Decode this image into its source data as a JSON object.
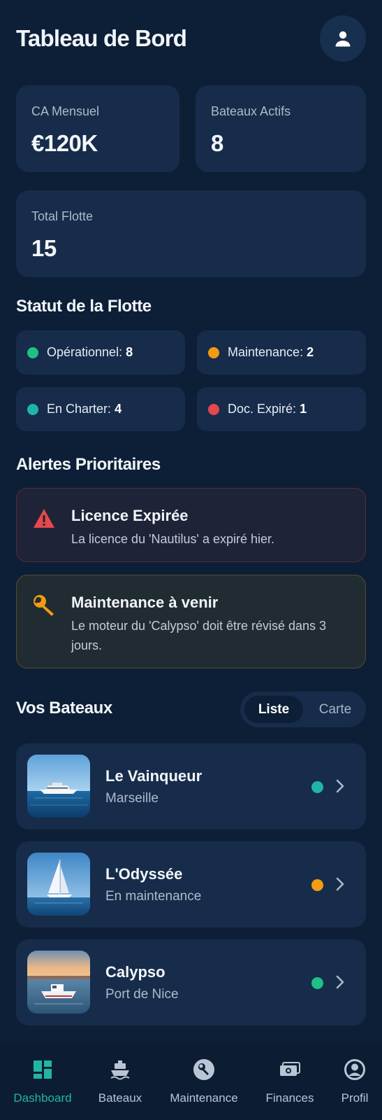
{
  "header": {
    "title": "Tableau de Bord",
    "avatar_icon": "person-icon"
  },
  "stats": [
    {
      "label": "CA Mensuel",
      "value": "€120K"
    },
    {
      "label": "Bateaux Actifs",
      "value": "8"
    },
    {
      "label": "Total Flotte",
      "value": "15"
    }
  ],
  "fleet_status": {
    "title": "Statut de la Flotte",
    "items": [
      {
        "label": "Opérationnel:",
        "count": "8",
        "color": "#1fbf86"
      },
      {
        "label": "Maintenance:",
        "count": "2",
        "color": "#f39c12"
      },
      {
        "label": "En Charter:",
        "count": "4",
        "color": "#1fb5a6"
      },
      {
        "label": "Doc. Expiré:",
        "count": "1",
        "color": "#e5484d"
      }
    ]
  },
  "alerts": {
    "title": "Alertes Prioritaires",
    "items": [
      {
        "icon": "warning-icon",
        "title": "Licence Expirée",
        "message": "La licence du 'Nautilus' a expiré hier.",
        "color": "#e5484d"
      },
      {
        "icon": "wrench-icon",
        "title": "Maintenance à venir",
        "message": "Le moteur du 'Calypso' doit être révisé dans 3 jours.",
        "color": "#f39c12"
      }
    ]
  },
  "boats": {
    "title": "Vos Bateaux",
    "view_toggle": {
      "options": [
        "Liste",
        "Carte"
      ],
      "selected": "Liste"
    },
    "items": [
      {
        "name": "Le Vainqueur",
        "subtitle": "Marseille",
        "status_color": "#1fb5a6"
      },
      {
        "name": "L'Odyssée",
        "subtitle": "En maintenance",
        "status_color": "#f39c12"
      },
      {
        "name": "Calypso",
        "subtitle": "Port de Nice",
        "status_color": "#1fbf86"
      }
    ]
  },
  "bottom_nav": {
    "items": [
      {
        "label": "Dashboard",
        "icon": "dashboard-icon",
        "active": true
      },
      {
        "label": "Bateaux",
        "icon": "boat-icon",
        "active": false
      },
      {
        "label": "Maintenance",
        "icon": "wrench-icon",
        "active": false
      },
      {
        "label": "Finances",
        "icon": "money-icon",
        "active": false
      },
      {
        "label": "Profil",
        "icon": "account-circle-icon",
        "active": false
      }
    ],
    "active_color": "#22b5a3"
  }
}
